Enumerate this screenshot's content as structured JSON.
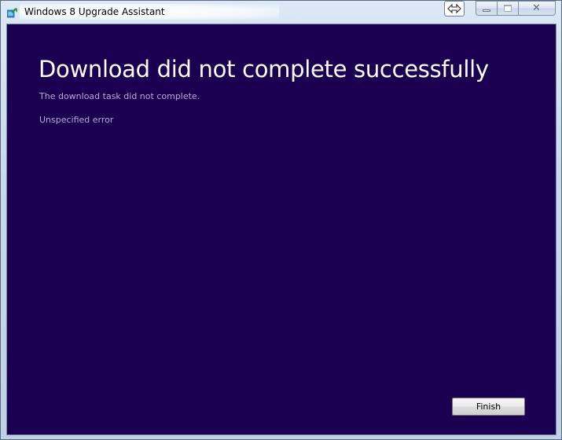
{
  "window": {
    "title": "Windows 8 Upgrade Assistant"
  },
  "caption": {
    "minimize_icon": "minimize-icon",
    "maximize_icon": "maximize-icon",
    "close_icon": "close-icon",
    "close_glyph": "✕",
    "resize_icon": "resize-arrows-icon"
  },
  "content": {
    "heading": "Download did not complete successfully",
    "message": "The download task did not complete.",
    "error": "Unspecified error"
  },
  "buttons": {
    "finish_label": "Finish"
  },
  "colors": {
    "background": "#1b0052",
    "heading_text": "#ffffff",
    "secondary_text": "#b6a9d6"
  }
}
